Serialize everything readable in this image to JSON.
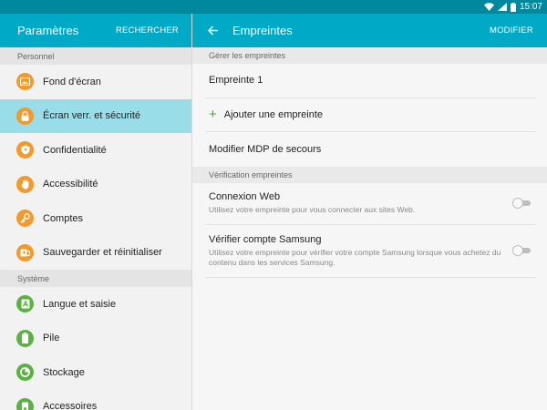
{
  "status_bar": {
    "time": "15:07",
    "battery": "100",
    "icons": [
      "wifi-icon",
      "signal-icon",
      "battery-icon"
    ]
  },
  "left": {
    "title": "Paramètres",
    "search_label": "RECHERCHER",
    "sections": [
      {
        "header": "Personnel",
        "items": [
          {
            "label": "Fond d'écran",
            "icon": "wallpaper-icon",
            "color": "#f29a2c",
            "active": false
          },
          {
            "label": "Écran verr. et sécurité",
            "icon": "lock-icon",
            "color": "#f29a2c",
            "active": true
          },
          {
            "label": "Confidentialité",
            "icon": "privacy-icon",
            "color": "#f29a2c",
            "active": false
          },
          {
            "label": "Accessibilité",
            "icon": "hand-icon",
            "color": "#f29a2c",
            "active": false
          },
          {
            "label": "Comptes",
            "icon": "key-icon",
            "color": "#f29a2c",
            "active": false
          },
          {
            "label": "Sauvegarder et réinitialiser",
            "icon": "backup-icon",
            "color": "#f29a2c",
            "active": false
          }
        ]
      },
      {
        "header": "Système",
        "items": [
          {
            "label": "Langue et saisie",
            "icon": "language-icon",
            "color": "#5bb142",
            "active": false
          },
          {
            "label": "Pile",
            "icon": "battery-icon",
            "color": "#5bb142",
            "active": false
          },
          {
            "label": "Stockage",
            "icon": "storage-icon",
            "color": "#5bb142",
            "active": false
          },
          {
            "label": "Accessoires",
            "icon": "accessories-icon",
            "color": "#5bb142",
            "active": false
          }
        ]
      }
    ]
  },
  "right": {
    "title": "Empreintes",
    "action_label": "MODIFIER",
    "manage_header": "Gérer les empreintes",
    "fingerprint_1": "Empreinte 1",
    "add_fingerprint": "Ajouter une empreinte",
    "backup_password": "Modifier MDP de secours",
    "verify_header": "Vérification empreintes",
    "web_login": {
      "title": "Connexion Web",
      "subtitle": "Utilisez votre empreinte pour vous connecter aux sites Web.",
      "enabled": false
    },
    "samsung_account": {
      "title": "Vérifier compte Samsung",
      "subtitle": "Utilisez votre empreinte pour vérifier votre compte Samsung lorsque vous achetez du contenu dans les services Samsung.",
      "enabled": false
    }
  },
  "colors": {
    "accent": "#00a9c5",
    "status_bar": "#00899e",
    "selected": "#98dde8",
    "orange_icon": "#f29a2c",
    "green_icon": "#5bb142"
  }
}
